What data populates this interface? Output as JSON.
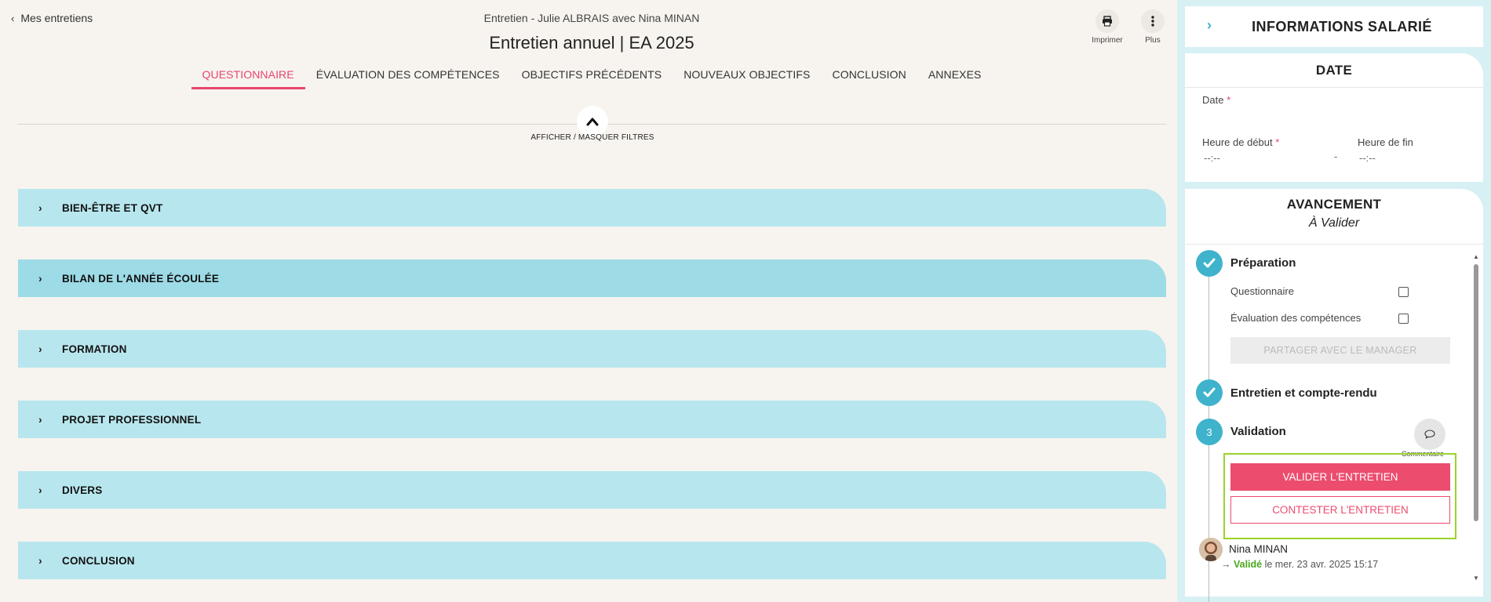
{
  "header": {
    "back_label": "Mes entretiens",
    "subtitle": "Entretien - Julie ALBRAIS avec Nina MINAN",
    "title": "Entretien annuel | EA 2025",
    "actions": [
      {
        "label": "Imprimer",
        "icon": "printer-icon"
      },
      {
        "label": "Plus",
        "icon": "more-vertical-icon"
      }
    ]
  },
  "tabs": [
    {
      "label": "QUESTIONNAIRE",
      "active": true
    },
    {
      "label": "ÉVALUATION DES COMPÉTENCES"
    },
    {
      "label": "OBJECTIFS PRÉCÉDENTS"
    },
    {
      "label": "NOUVEAUX OBJECTIFS"
    },
    {
      "label": "CONCLUSION"
    },
    {
      "label": "ANNEXES"
    }
  ],
  "filters": {
    "toggle_label": "AFFICHER / MASQUER FILTRES"
  },
  "sections": [
    {
      "label": "BIEN-ÊTRE ET QVT"
    },
    {
      "label": "BILAN DE L'ANNÉE ÉCOULÉE"
    },
    {
      "label": "FORMATION"
    },
    {
      "label": "PROJET PROFESSIONNEL"
    },
    {
      "label": "DIVERS"
    },
    {
      "label": "CONCLUSION"
    }
  ],
  "sidebar": {
    "info_title": "INFORMATIONS SALARIÉ",
    "date": {
      "title": "DATE",
      "date_label": "Date",
      "start_label": "Heure de début",
      "end_label": "Heure de fin",
      "start_value": "--:--",
      "end_value": "--:--",
      "separator": "-",
      "required_mark": "*"
    },
    "progress": {
      "title": "AVANCEMENT",
      "status": "À Valider",
      "steps": [
        {
          "title": "Préparation",
          "state": "done"
        },
        {
          "title": "Entretien et compte-rendu",
          "state": "done"
        },
        {
          "title": "Validation",
          "number": "3"
        }
      ],
      "prep_items": [
        "Questionnaire",
        "Évaluation des compétences"
      ],
      "share_label": "PARTAGER AVEC LE MANAGER",
      "comment_label": "Commentaire",
      "validate_label": "VALIDER L'ENTRETIEN",
      "contest_label": "CONTESTER L'ENTRETIEN",
      "validation": {
        "name": "Nina MINAN",
        "arrow": "→",
        "status": "Validé",
        "text": "le mer. 23 avr. 2025 15:17"
      }
    }
  },
  "colors": {
    "accent": "#e8456c",
    "teal": "#3fb3cb",
    "section_bg": "#b8e6ee",
    "highlight": "#9bd32b"
  }
}
